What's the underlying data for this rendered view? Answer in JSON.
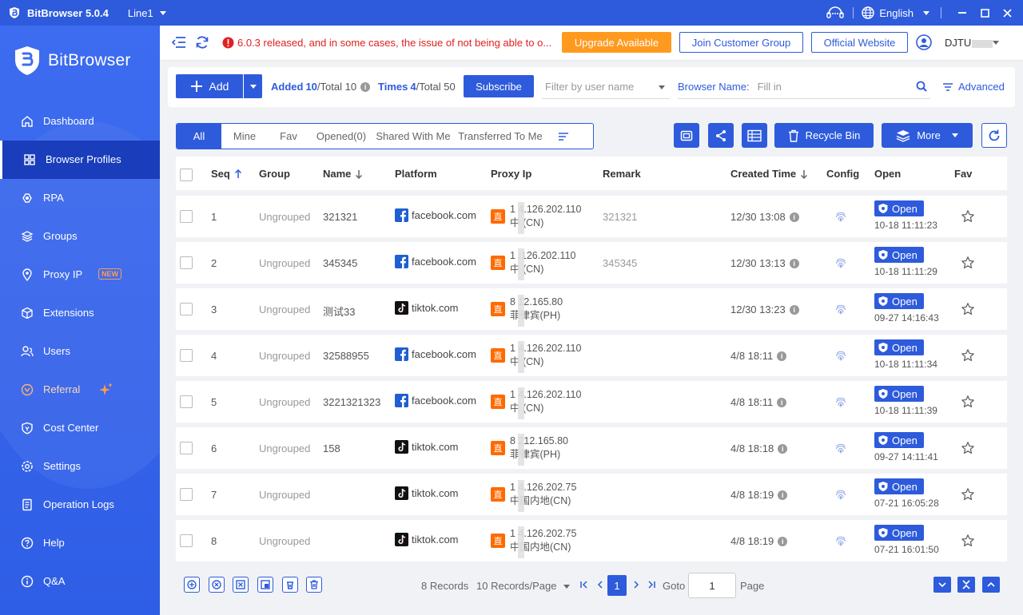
{
  "titlebar": {
    "app_title": "BitBrowser 5.0.4",
    "line": "Line1",
    "language": "English"
  },
  "sidebar": {
    "brand": "BitBrowser",
    "items": [
      {
        "label": "Dashboard",
        "icon": "home-icon"
      },
      {
        "label": "Browser Profiles",
        "icon": "grid-icon"
      },
      {
        "label": "RPA",
        "icon": "rpa-icon"
      },
      {
        "label": "Groups",
        "icon": "layers-icon"
      },
      {
        "label": "Proxy IP",
        "icon": "location-icon",
        "badge": "NEW"
      },
      {
        "label": "Extensions",
        "icon": "cube-icon"
      },
      {
        "label": "Users",
        "icon": "users-icon"
      },
      {
        "label": "Referral",
        "icon": "referral-icon"
      },
      {
        "label": "Cost Center",
        "icon": "shield-dollar-icon"
      },
      {
        "label": "Settings",
        "icon": "gear-icon"
      },
      {
        "label": "Operation Logs",
        "icon": "log-icon"
      },
      {
        "label": "Help",
        "icon": "help-icon"
      },
      {
        "label": "Q&A",
        "icon": "info-icon"
      }
    ]
  },
  "topbar": {
    "notice": "6.0.3 released, and in some cases, the issue of not being able to o...",
    "upgrade": "Upgrade Available",
    "join": "Join Customer Group",
    "website": "Official Website",
    "user": "DJTU"
  },
  "filter": {
    "add": "Add",
    "added_label": "Added",
    "added_value": "10",
    "added_total": "/Total 10",
    "times_label": "Times",
    "times_value": "4",
    "times_total": "/Total 50",
    "subscribe": "Subscribe",
    "user_placeholder": "Filter by user name",
    "browser_name_label": "Browser Name:",
    "browser_name_placeholder": "Fill in",
    "advanced": "Advanced"
  },
  "tabs": [
    "All",
    "Mine",
    "Fav",
    "Opened(0)",
    "Shared With Me",
    "Transferred To Me"
  ],
  "toolbar": {
    "recycle": "Recycle Bin",
    "more": "More"
  },
  "table": {
    "headers": {
      "seq": "Seq",
      "group": "Group",
      "name": "Name",
      "platform": "Platform",
      "proxy": "Proxy Ip",
      "remark": "Remark",
      "created": "Created Time",
      "config": "Config",
      "open": "Open",
      "fav": "Fav"
    },
    "proxy_badge": "直",
    "open_label": "Open",
    "rows": [
      {
        "seq": "1",
        "group": "Ungrouped",
        "name": "321321",
        "platform": "facebook.com",
        "ptype": "facebook",
        "ip": "1 4.126.202.110",
        "loc": "中 (CN)",
        "remark": "321321",
        "created": "12/30 13:08",
        "opened": "10-18 11:11:23"
      },
      {
        "seq": "2",
        "group": "Ungrouped",
        "name": "345345",
        "platform": "facebook.com",
        "ptype": "facebook",
        "ip": "1 .126.202.110",
        "loc": "中 (CN)",
        "remark": "345345",
        "created": "12/30 13:13",
        "opened": "10-18 11:11:29"
      },
      {
        "seq": "3",
        "group": "Ungrouped",
        "name": "测试33",
        "platform": "tiktok.com",
        "ptype": "tiktok",
        "ip": "8 12.165.80",
        "loc": "菲律宾(PH)",
        "remark": "",
        "created": "12/30 13:23",
        "opened": "09-27 14:16:43"
      },
      {
        "seq": "4",
        "group": "Ungrouped",
        "name": "32588955",
        "platform": "facebook.com",
        "ptype": "facebook",
        "ip": "1 4.126.202.110",
        "loc": "中 (CN)",
        "remark": "",
        "created": "4/8 18:11",
        "opened": "10-18 11:11:34"
      },
      {
        "seq": "5",
        "group": "Ungrouped",
        "name": "3221321323",
        "platform": "facebook.com",
        "ptype": "facebook",
        "ip": "1 4.126.202.110",
        "loc": "中 (CN)",
        "remark": "",
        "created": "4/8 18:11",
        "opened": "10-18 11:11:39"
      },
      {
        "seq": "6",
        "group": "Ungrouped",
        "name": "158",
        "platform": "tiktok.com",
        "ptype": "tiktok",
        "ip": "8 212.165.80",
        "loc": "菲律宾(PH)",
        "remark": "",
        "created": "4/8 18:18",
        "opened": "09-27 14:11:41"
      },
      {
        "seq": "7",
        "group": "Ungrouped",
        "name": "",
        "platform": "tiktok.com",
        "ptype": "tiktok",
        "ip": "1 4.126.202.75",
        "loc": "中国内地(CN)",
        "remark": "",
        "created": "4/8 18:19",
        "opened": "07-21 16:05:28"
      },
      {
        "seq": "8",
        "group": "Ungrouped",
        "name": "",
        "platform": "tiktok.com",
        "ptype": "tiktok",
        "ip": "1 4.126.202.75",
        "loc": "中国内地(CN)",
        "remark": "",
        "created": "4/8 18:19",
        "opened": "07-21 16:01:50"
      }
    ]
  },
  "pagination": {
    "records": "8 Records",
    "per_page": "10 Records/Page",
    "current": "1",
    "goto_label": "Goto",
    "goto_value": "1",
    "page_label": "Page"
  },
  "colors": {
    "primary": "#2e5bdc",
    "sidebar": "#3d6cf0",
    "active": "#193dbb",
    "upgrade": "#ff9a1f",
    "notice": "#e02020"
  }
}
